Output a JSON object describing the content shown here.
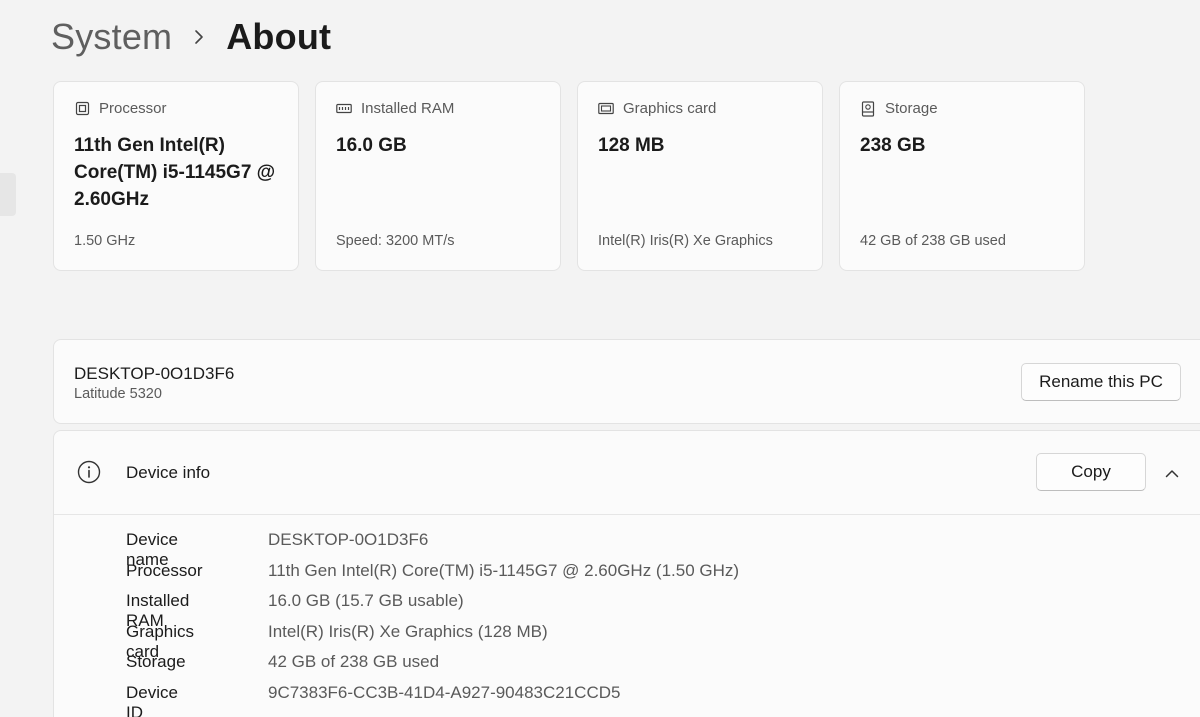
{
  "breadcrumb": {
    "parent": "System",
    "separator_icon": "chevron-right-icon",
    "current": "About"
  },
  "specs": [
    {
      "icon": "processor-icon",
      "title": "Processor",
      "value": "11th Gen Intel(R) Core(TM) i5-1145G7 @ 2.60GHz",
      "sub": "1.50 GHz"
    },
    {
      "icon": "ram-icon",
      "title": "Installed RAM",
      "value": "16.0 GB",
      "sub": "Speed: 3200 MT/s"
    },
    {
      "icon": "graphics-card-icon",
      "title": "Graphics card",
      "value": "128 MB",
      "sub": "Intel(R) Iris(R) Xe Graphics"
    },
    {
      "icon": "storage-icon",
      "title": "Storage",
      "value": "238 GB",
      "sub": "42 GB of 238 GB used"
    }
  ],
  "pc": {
    "name": "DESKTOP-0O1D3F6",
    "model": "Latitude 5320",
    "rename_label": "Rename this PC"
  },
  "device_info": {
    "icon": "info-icon",
    "title": "Device info",
    "copy_label": "Copy",
    "collapse_icon": "chevron-up-icon",
    "rows": [
      {
        "label": "Device name",
        "value": "DESKTOP-0O1D3F6"
      },
      {
        "label": "Processor",
        "value": "11th Gen Intel(R) Core(TM) i5-1145G7 @ 2.60GHz (1.50 GHz)"
      },
      {
        "label": "Installed RAM",
        "value": "16.0 GB (15.7 GB usable)"
      },
      {
        "label": "Graphics card",
        "value": "Intel(R) Iris(R) Xe Graphics (128 MB)"
      },
      {
        "label": "Storage",
        "value": "42 GB of 238 GB used"
      },
      {
        "label": "Device ID",
        "value": "9C7383F6-CC3B-41D4-A927-90483C21CCD5"
      }
    ]
  },
  "colors": {
    "background": "#f3f3f3",
    "card": "#fbfbfb",
    "border": "#e3e3e3",
    "text_primary": "#1b1b1b",
    "text_secondary": "#5a5a5a"
  }
}
